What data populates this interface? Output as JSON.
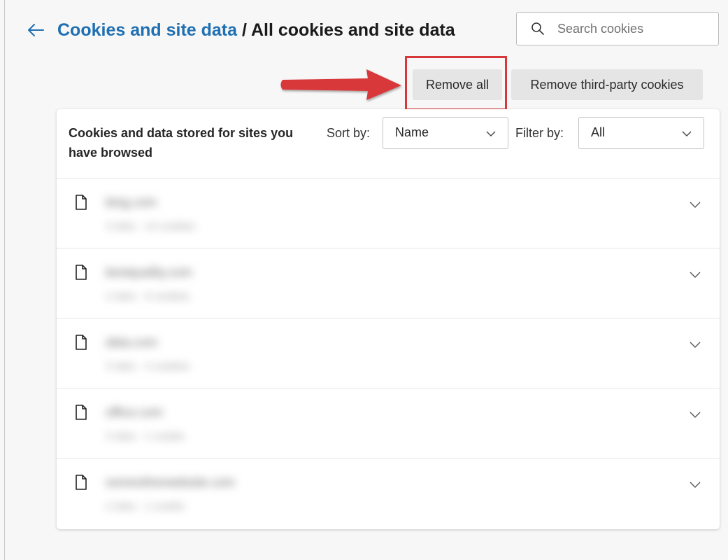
{
  "header": {
    "breadcrumb_parent": "Cookies and site data",
    "breadcrumb_separator": " / ",
    "breadcrumb_current": "All cookies and site data"
  },
  "search": {
    "placeholder": "Search cookies",
    "value": ""
  },
  "actions": {
    "remove_all_label": "Remove all",
    "remove_third_party_label": "Remove third-party cookies"
  },
  "annotation": {
    "highlight_color": "#d9383a",
    "arrow_color": "#d9383a"
  },
  "list": {
    "title": "Cookies and data stored for sites you have browsed",
    "sort_label": "Sort by:",
    "sort_value": "Name",
    "filter_label": "Filter by:",
    "filter_value": "All",
    "items": [
      {
        "name": "bing.com",
        "meta": "3 sites · 14 cookies"
      },
      {
        "name": "bestquality.com",
        "meta": "2 sites · 6 cookies"
      },
      {
        "name": "data.com",
        "meta": "3 sites · 4 cookies"
      },
      {
        "name": "office.com",
        "meta": "3 sites · 1 cookie"
      },
      {
        "name": "someotherwebsite.com",
        "meta": "2 sites · 1 cookie"
      }
    ]
  },
  "colors": {
    "link": "#1f6fb2",
    "button_bg": "#e5e5e5",
    "card_bg": "#ffffff",
    "page_bg": "#f7f7f7"
  }
}
